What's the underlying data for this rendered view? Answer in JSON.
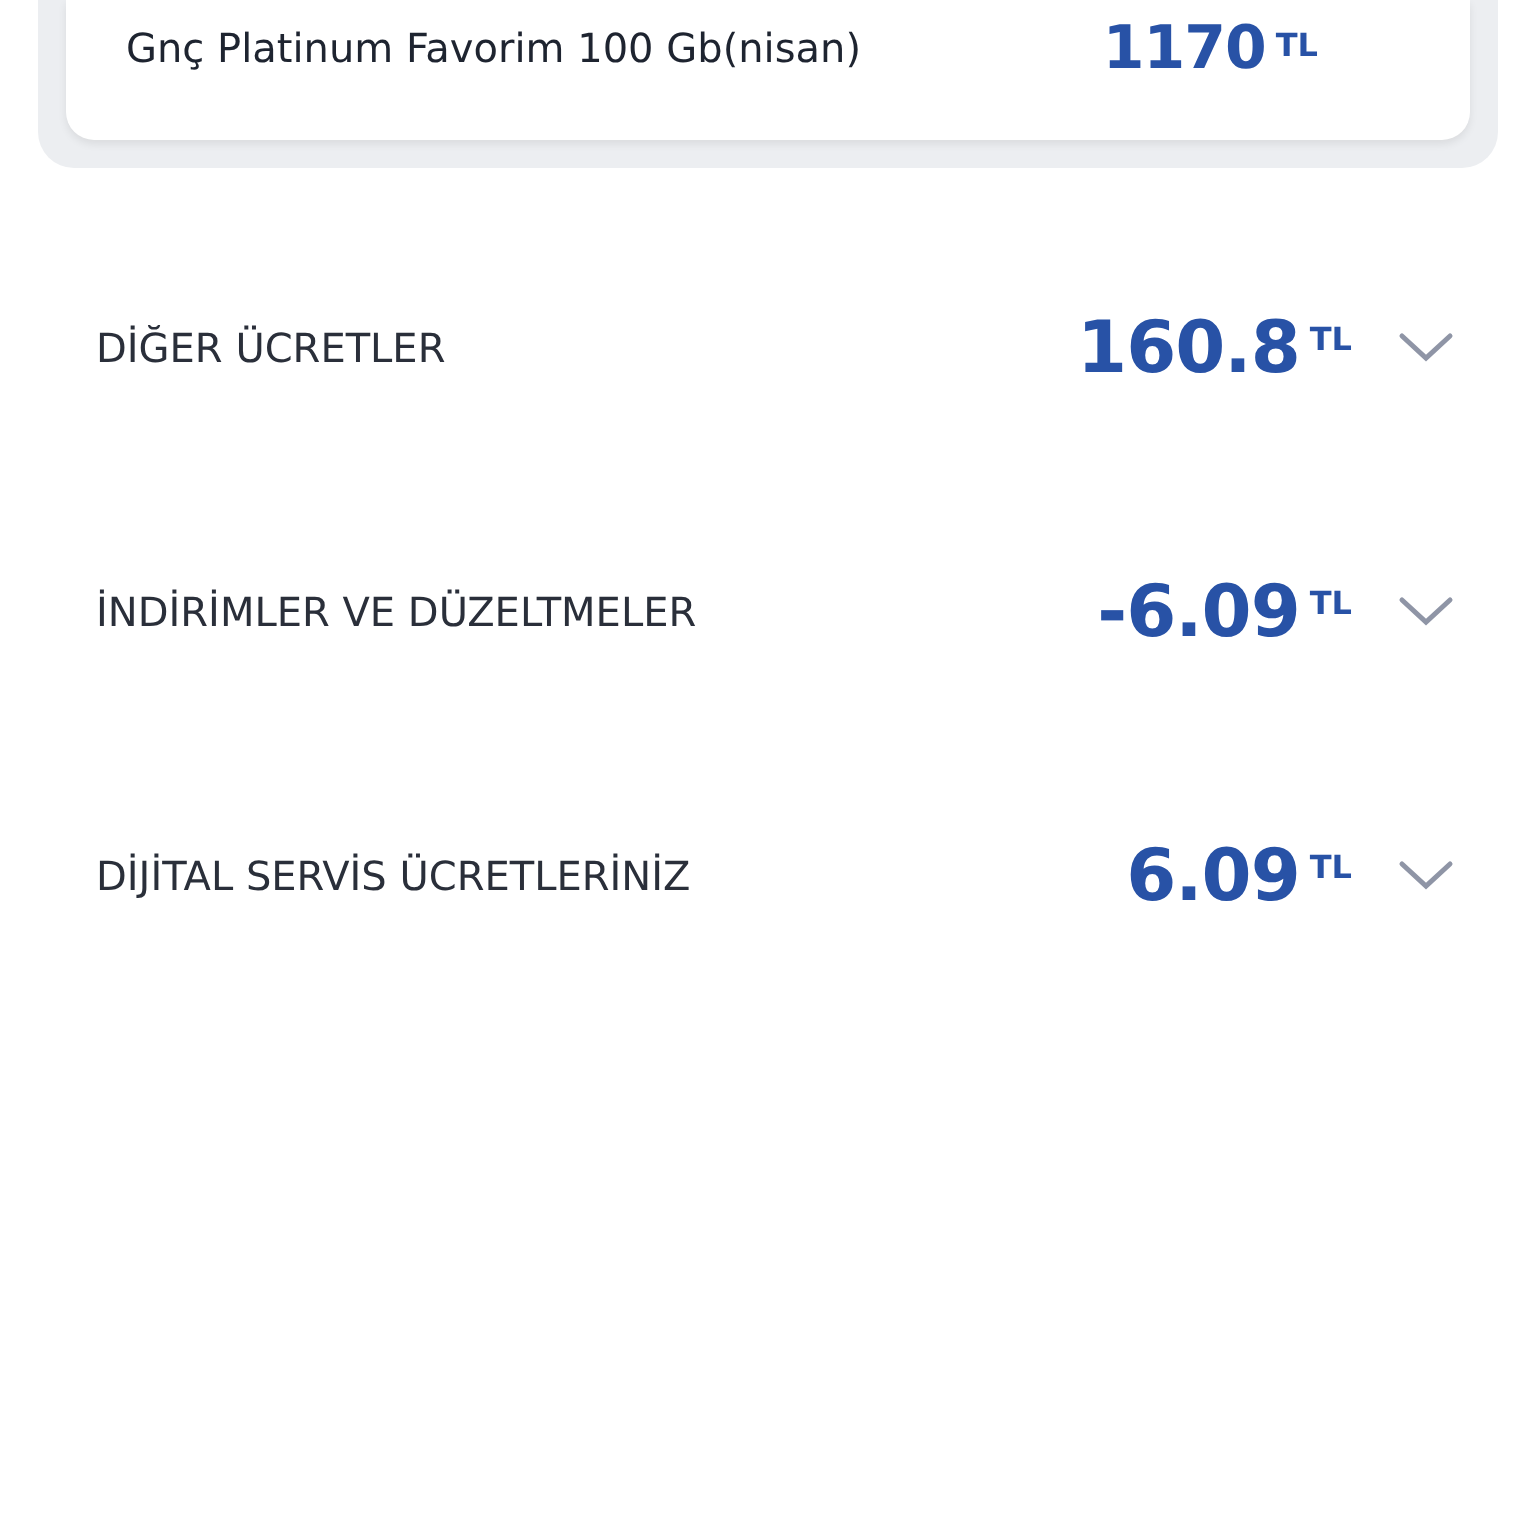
{
  "package_card": {
    "name": "Gnç Platinum Favorim 100 Gb(nisan)",
    "amount": "1170",
    "currency": "TL"
  },
  "sections": [
    {
      "title": "DİĞER ÜCRETLER",
      "amount": "160.8",
      "currency": "TL",
      "expanded": false
    },
    {
      "title": "İNDİRİMLER VE DÜZELTMELER",
      "amount": "-6.09",
      "currency": "TL",
      "expanded": false
    },
    {
      "title": "DİJİTAL SERVİS ÜCRETLERİNİZ",
      "amount": "6.09",
      "currency": "TL",
      "expanded": false
    }
  ]
}
